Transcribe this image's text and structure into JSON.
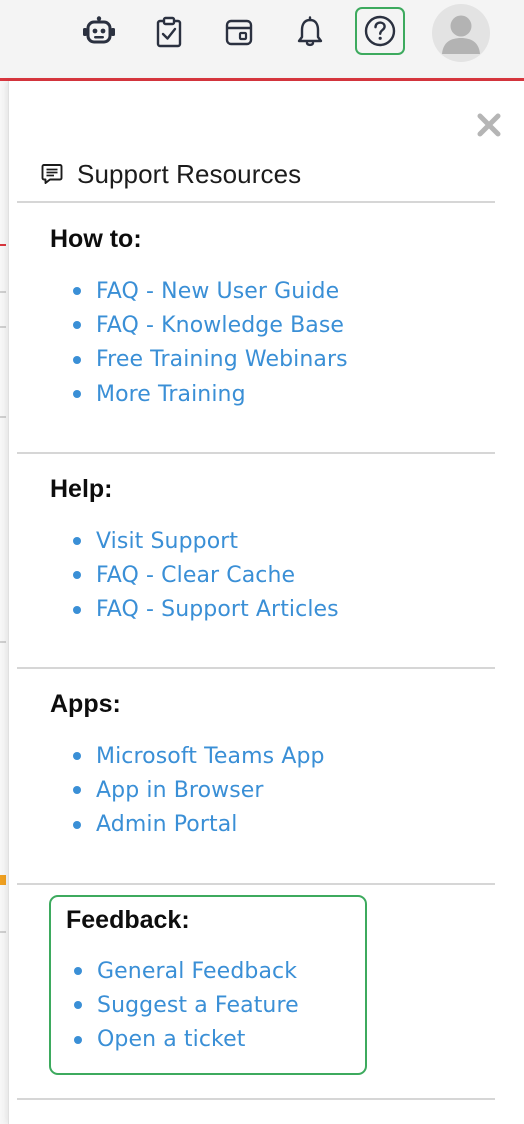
{
  "topbar": {
    "icons": [
      "robot-icon",
      "clipboard-check-icon",
      "calendar-icon",
      "bell-icon",
      "help-icon",
      "avatar-icon"
    ],
    "colors": {
      "accent_bar": "#d9363e",
      "highlight": "#3daa5e"
    }
  },
  "panel": {
    "title": "Support Resources",
    "close_icon": "close-icon",
    "header_icon": "list-document-icon",
    "link_color": "#3a8fd6",
    "sections": [
      {
        "title": "How to:",
        "links": [
          "FAQ - New User Guide",
          "FAQ - Knowledge Base",
          "Free Training Webinars",
          "More Training"
        ]
      },
      {
        "title": "Help:",
        "links": [
          "Visit Support",
          "FAQ - Clear Cache",
          "FAQ - Support Articles"
        ]
      },
      {
        "title": "Apps:",
        "links": [
          "Microsoft Teams App",
          "App in Browser",
          "Admin Portal"
        ]
      },
      {
        "title": "Feedback:",
        "links": [
          "General Feedback",
          "Suggest a Feature",
          "Open a ticket"
        ]
      }
    ]
  }
}
